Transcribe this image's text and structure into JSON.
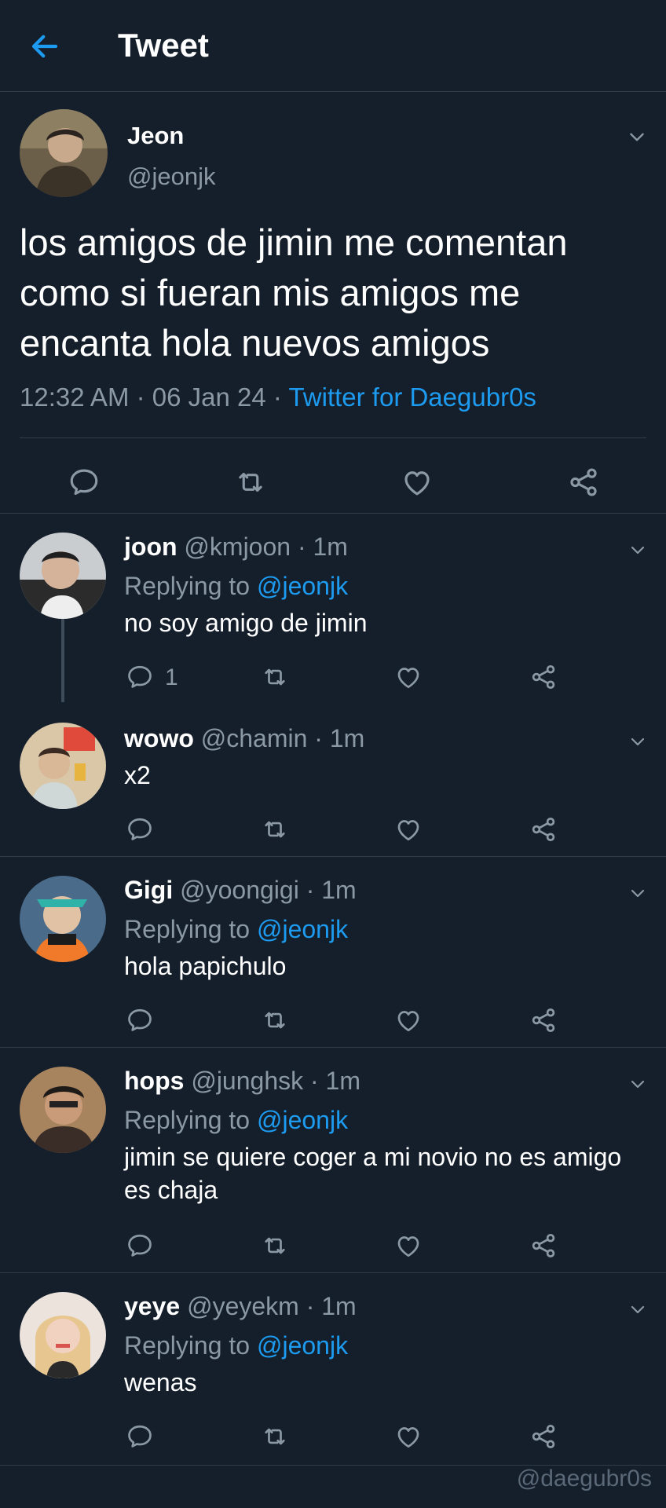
{
  "header": {
    "title": "Tweet"
  },
  "main_tweet": {
    "name": "Jeon",
    "handle": "@jeonjk",
    "text": "los amigos de jimin me comentan como si fueran mis amigos me encanta hola nuevos amigos",
    "time": "12:32 AM · 06 Jan 24 · ",
    "source": "Twitter for Daegubr0s"
  },
  "replies": [
    {
      "name": "joon",
      "handle": "@kmjoon · 1m",
      "replying_label": "Replying to ",
      "mention": "@jeonjk",
      "text": "no soy amigo de jimin",
      "reply_count": "1"
    },
    {
      "name": "wowo",
      "handle": "@chamin · 1m",
      "text": "x2"
    },
    {
      "name": "Gigi",
      "handle": "@yoongigi · 1m",
      "replying_label": "Replying to ",
      "mention": "@jeonjk",
      "text": "hola papichulo"
    },
    {
      "name": "hops",
      "handle": "@junghsk · 1m",
      "replying_label": "Replying to ",
      "mention": "@jeonjk",
      "text": "jimin se quiere coger a mi novio no es amigo es chaja"
    },
    {
      "name": "yeye",
      "handle": "@yeyekm · 1m",
      "replying_label": "Replying to ",
      "mention": "@jeonjk",
      "text": "wenas"
    }
  ],
  "watermark": "@daegubr0s",
  "colors": {
    "background": "#151f2b",
    "accent": "#1d9bf0",
    "secondary_text": "#8b98a5",
    "divider": "#2f3b48"
  },
  "icons": [
    "back-arrow-icon",
    "chevron-down-icon",
    "comment-icon",
    "retweet-icon",
    "heart-icon",
    "share-icon"
  ]
}
